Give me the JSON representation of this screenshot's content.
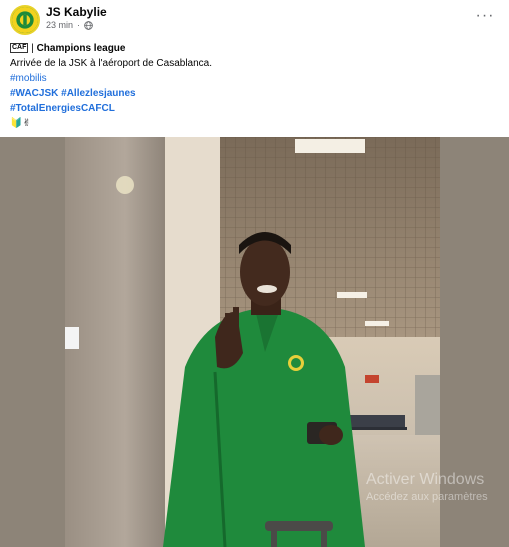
{
  "post": {
    "author": "JS Kabylie",
    "time": "23 min",
    "dot": "·",
    "more_label": "···",
    "caf_logo_text": "CAF",
    "competition": "Champions league",
    "separator": "|",
    "message": "Arrivée de la JSK à l'aéroport de Casablanca.",
    "hashtags": {
      "mobilis": "#mobilis",
      "wacjsk": "#WACJSK",
      "allez": "#Allezlesjaunes",
      "total": "#TotalEnergiesCAFCL"
    },
    "emojis": "🔰✌"
  },
  "watermark": {
    "title": "Activer Windows",
    "subtitle": "Accédez aux paramètres"
  },
  "colors": {
    "hashtag": "#216fdb",
    "jersey_green": "#1f8a3c",
    "avatar_yellow": "#e8d22a"
  },
  "icons": {
    "avatar": "jsk-crest",
    "visibility": "globe-icon",
    "menu": "more-options-icon"
  }
}
